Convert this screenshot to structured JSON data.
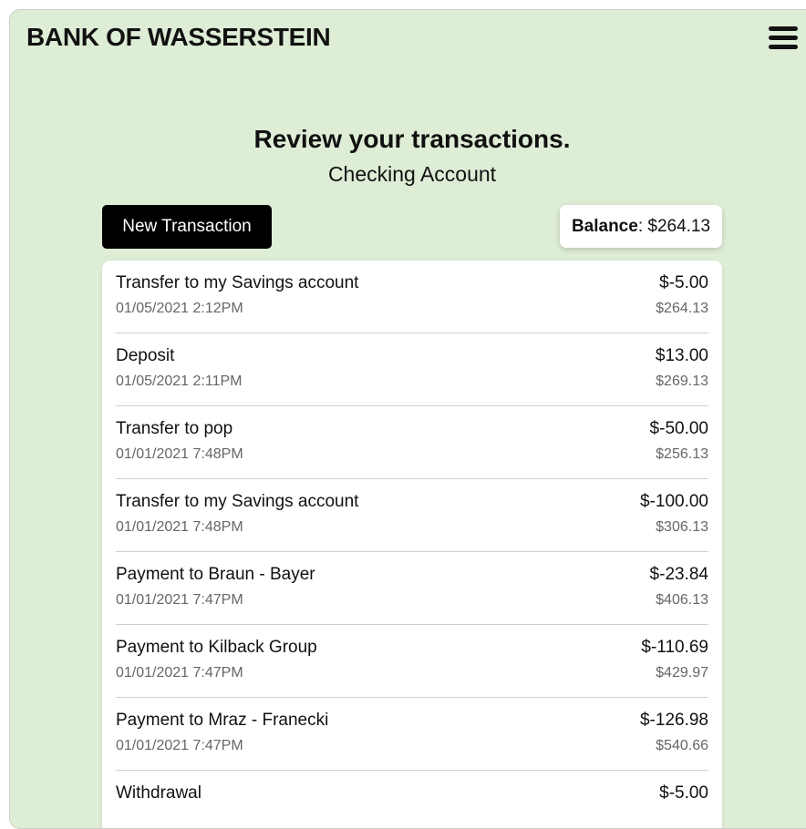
{
  "header": {
    "brand": "BANK OF WASSERSTEIN",
    "menu_icon": "hamburger-menu-icon"
  },
  "page": {
    "title": "Review your transactions.",
    "subtitle": "Checking Account"
  },
  "actions": {
    "new_transaction_label": "New Transaction"
  },
  "balance": {
    "label": "Balance",
    "value": "$264.13"
  },
  "transactions": [
    {
      "name": "Transfer to my Savings account",
      "date": "01/05/2021 2:12PM",
      "amount": "$-5.00",
      "running_balance": "$264.13"
    },
    {
      "name": "Deposit",
      "date": "01/05/2021 2:11PM",
      "amount": "$13.00",
      "running_balance": "$269.13"
    },
    {
      "name": "Transfer to pop",
      "date": "01/01/2021 7:48PM",
      "amount": "$-50.00",
      "running_balance": "$256.13"
    },
    {
      "name": "Transfer to my Savings account",
      "date": "01/01/2021 7:48PM",
      "amount": "$-100.00",
      "running_balance": "$306.13"
    },
    {
      "name": "Payment to Braun - Bayer",
      "date": "01/01/2021 7:47PM",
      "amount": "$-23.84",
      "running_balance": "$406.13"
    },
    {
      "name": "Payment to Kilback Group",
      "date": "01/01/2021 7:47PM",
      "amount": "$-110.69",
      "running_balance": "$429.97"
    },
    {
      "name": "Payment to Mraz - Franecki",
      "date": "01/01/2021 7:47PM",
      "amount": "$-126.98",
      "running_balance": "$540.66"
    },
    {
      "name": "Withdrawal",
      "amount": "$-5.00"
    }
  ],
  "colors": {
    "background": "#deedd6",
    "button": "#000000",
    "card": "#ffffff"
  }
}
